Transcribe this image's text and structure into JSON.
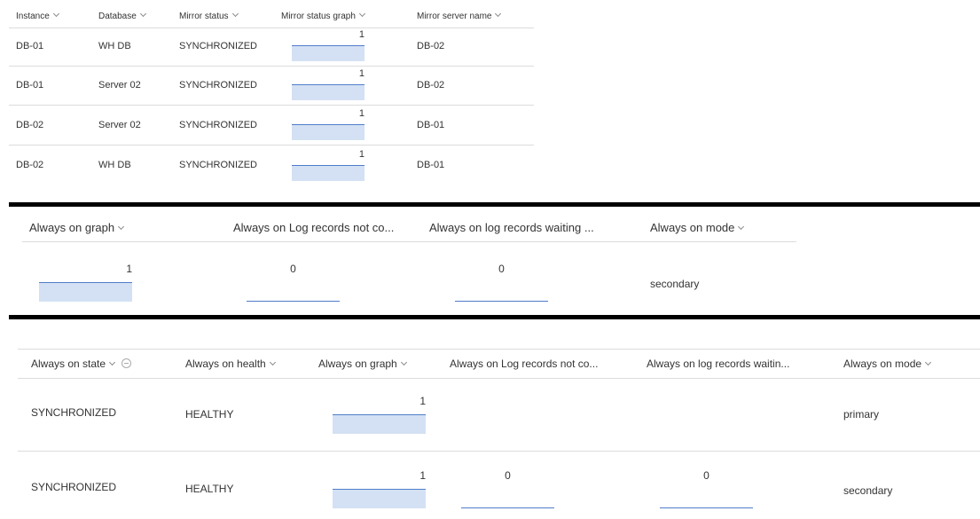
{
  "colors": {
    "bar_fill": "#d4e1f4",
    "bar_line": "#4f7dc9",
    "divider": "#000000"
  },
  "mirror": {
    "headers": [
      "Instance",
      "Database",
      "Mirror status",
      "Mirror status graph",
      "Mirror server name"
    ],
    "rows": [
      {
        "instance": "DB-01",
        "database": "WH DB",
        "status": "SYNCHRONIZED",
        "graph": "1",
        "server": "DB-02"
      },
      {
        "instance": "DB-01",
        "database": "Server 02",
        "status": "SYNCHRONIZED",
        "graph": "1",
        "server": "DB-02"
      },
      {
        "instance": "DB-02",
        "database": "Server 02",
        "status": "SYNCHRONIZED",
        "graph": "1",
        "server": "DB-01"
      },
      {
        "instance": "DB-02",
        "database": "WH DB",
        "status": "SYNCHRONIZED",
        "graph": "1",
        "server": "DB-01"
      }
    ]
  },
  "always_on_single": {
    "headers": [
      "Always on graph",
      "Always on Log records not co...",
      "Always on log records waiting ...",
      "Always on mode"
    ],
    "row": {
      "graph": "1",
      "log_not_committed": "0",
      "log_waiting": "0",
      "mode": "secondary"
    }
  },
  "always_on_full": {
    "headers": [
      "Always on state",
      "Always on health",
      "Always on graph",
      "Always on Log records not co...",
      "Always on log records waitin...",
      "Always on mode"
    ],
    "rows": [
      {
        "state": "SYNCHRONIZED",
        "health": "HEALTHY",
        "graph": "1",
        "log_not_committed": "",
        "log_waiting": "",
        "mode": "primary"
      },
      {
        "state": "SYNCHRONIZED",
        "health": "HEALTHY",
        "graph": "1",
        "log_not_committed": "0",
        "log_waiting": "0",
        "mode": "secondary"
      }
    ]
  }
}
